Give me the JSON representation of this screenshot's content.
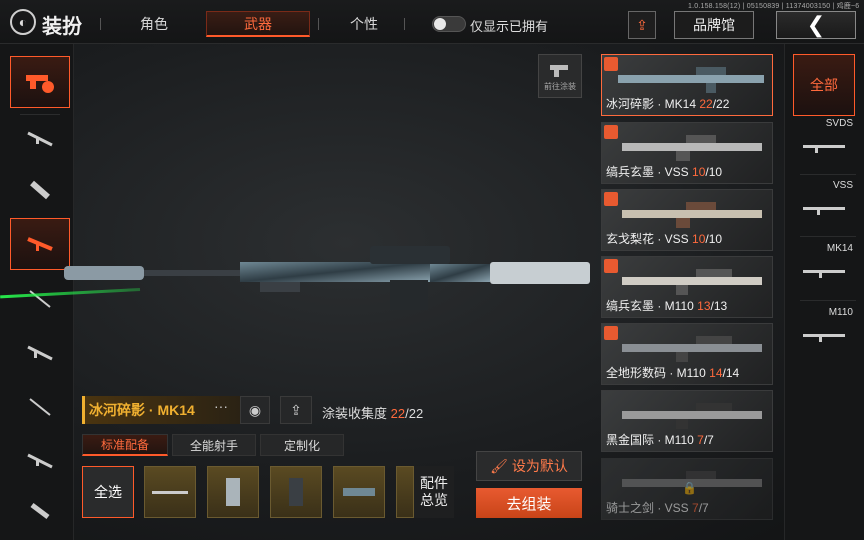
{
  "top_bar": {
    "title": "装扮",
    "tabs": [
      "角色",
      "武器",
      "个性"
    ],
    "active_tab": "武器",
    "owned_toggle_label": "仅显示已拥有",
    "brand_hall": "品牌馆",
    "version": "1.0.158.158(12) | 05150839 | 11374003150 | 鸡鹿~6"
  },
  "main": {
    "paint_shortcut_label": "前往涂装",
    "weapon_name": "冰河碎影 · MK14",
    "more": "···",
    "collect_label": "涂装收集度",
    "collect_current": "22",
    "collect_total": "/22",
    "subtabs": [
      "标准配备",
      "全能射手",
      "定制化"
    ],
    "select_all": "全选",
    "overview_line1": "配件",
    "overview_line2": "总览",
    "set_default": "设为默认",
    "assemble": "去组装"
  },
  "skins": [
    {
      "name": "冰河碎影 · MK14",
      "owned": "22",
      "total": "/22"
    },
    {
      "name": "缟兵玄墨 · VSS",
      "owned": "10",
      "total": "/10"
    },
    {
      "name": "玄戈梨花 · VSS",
      "owned": "10",
      "total": "/10"
    },
    {
      "name": "缟兵玄墨 · M110",
      "owned": "13",
      "total": "/13"
    },
    {
      "name": "全地形数码 · M110",
      "owned": "14",
      "total": "/14"
    },
    {
      "name": "黑金国际 · M110",
      "owned": "7",
      "total": "/7"
    },
    {
      "name": "骑士之剑 · VSS",
      "owned": "7",
      "total": "/7"
    }
  ],
  "filter": {
    "all": "全部",
    "types": [
      "SVDS",
      "VSS",
      "MK14",
      "M110"
    ]
  },
  "colors": {
    "accent": "#ff5a2a",
    "gold": "#f0b030"
  }
}
